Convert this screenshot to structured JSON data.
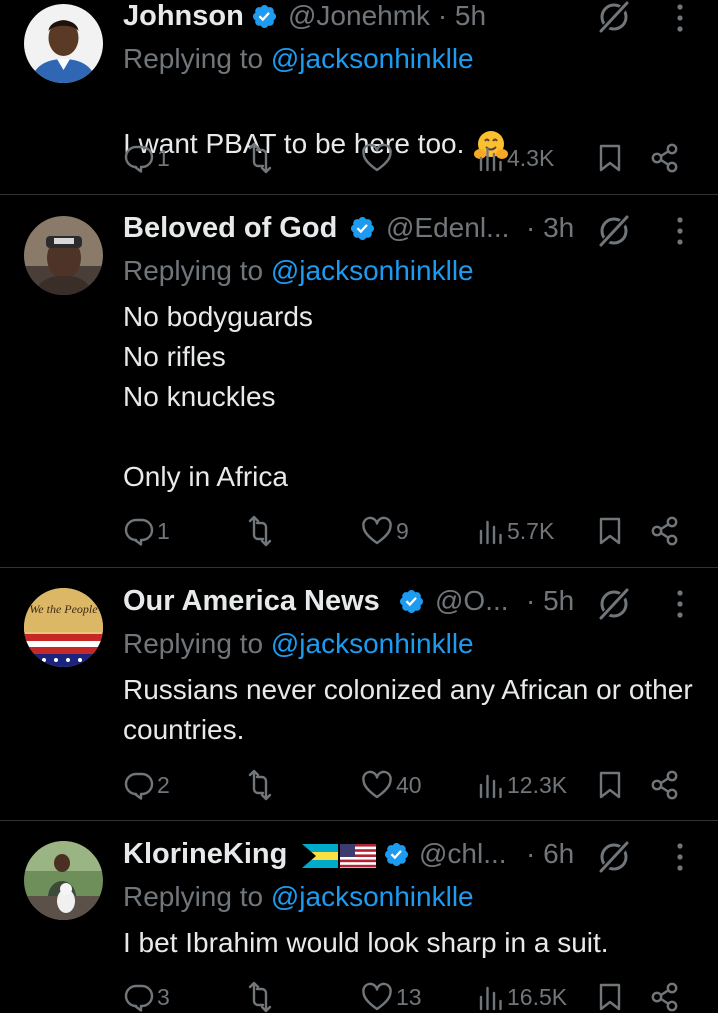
{
  "tweets": [
    {
      "name": "Johnson",
      "handle": "@Jonehmk · 5h",
      "replying_prefix": "Replying to ",
      "replying_to": "@jacksonhinklle",
      "text": "I want PBAT to be here too.",
      "emoji": "hugging-face",
      "replies": "1",
      "reposts": "",
      "likes": "",
      "views": "4.3K"
    },
    {
      "name": "Beloved of God",
      "handle": "@Edenl...",
      "time": "· 3h",
      "replying_prefix": "Replying to ",
      "replying_to": "@jacksonhinklle",
      "text": "No bodyguards\nNo rifles\nNo knuckles\n\nOnly in Africa",
      "replies": "1",
      "reposts": "",
      "likes": "9",
      "views": "5.7K"
    },
    {
      "name": "Our America News",
      "handle": "@O...",
      "time": "· 5h",
      "replying_prefix": "Replying to ",
      "replying_to": "@jacksonhinklle",
      "text": "Russians never colonized any African or other countries.",
      "avatar_text": "We the People",
      "replies": "2",
      "reposts": "",
      "likes": "40",
      "views": "12.3K"
    },
    {
      "name": "KlorineKing",
      "flags": [
        "bahamas-flag",
        "us-flag"
      ],
      "handle": "@chl...",
      "time": "· 6h",
      "replying_prefix": "Replying to ",
      "replying_to": "@jacksonhinklle",
      "text": "I bet Ibrahim would look sharp in a suit.",
      "replies": "3",
      "reposts": "",
      "likes": "13",
      "views": "16.5K"
    }
  ],
  "colors": {
    "background": "#000000",
    "text": "#e7e9ea",
    "muted": "#71767b",
    "accent": "#1d9bf0",
    "divider": "#2f3336"
  },
  "icons": [
    "verified-badge-icon",
    "grok-icon",
    "more-options-icon",
    "reply-icon",
    "repost-icon",
    "like-icon",
    "views-icon",
    "bookmark-icon",
    "share-icon"
  ]
}
